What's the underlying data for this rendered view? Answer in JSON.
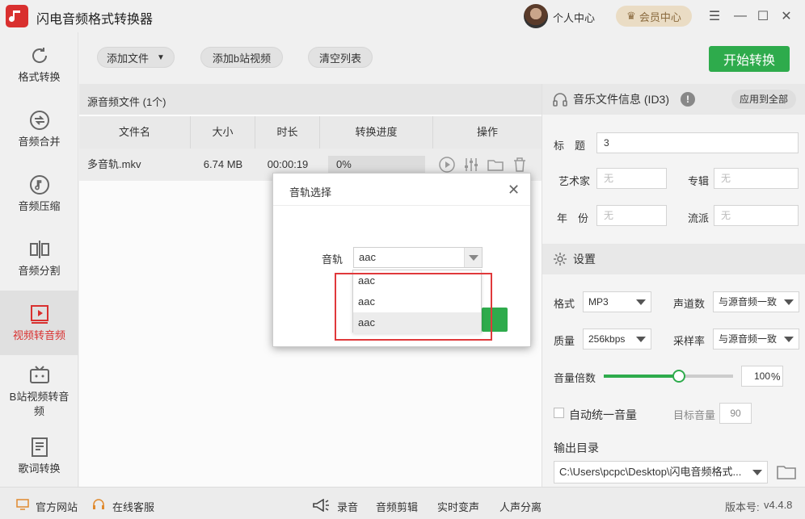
{
  "app": {
    "title": "闪电音频格式转换器",
    "user_center": "个人中心",
    "vip": "会员中心"
  },
  "sidebar": {
    "items": [
      {
        "label": "格式转换"
      },
      {
        "label": "音频合并"
      },
      {
        "label": "音频压缩"
      },
      {
        "label": "音频分割"
      },
      {
        "label": "视频转音频"
      },
      {
        "label": "B站视频转音频"
      },
      {
        "label": "歌词转换"
      }
    ]
  },
  "toolbar": {
    "add_file": "添加文件",
    "add_bili": "添加b站视频",
    "clear": "清空列表",
    "start": "开始转换"
  },
  "files": {
    "header": "源音频文件 (1个)",
    "columns": [
      "文件名",
      "大小",
      "时长",
      "转换进度",
      "操作"
    ],
    "rows": [
      {
        "name": "多音轨.mkv",
        "size": "6.74 MB",
        "duration": "00:00:19",
        "progress": "0%"
      }
    ]
  },
  "id3": {
    "title": "音乐文件信息 (ID3)",
    "apply_all": "应用到全部",
    "label_title": "标　题",
    "value_title": "3",
    "label_artist": "艺术家",
    "ph_artist": "无",
    "label_album": "专辑",
    "ph_album": "无",
    "label_year": "年　份",
    "ph_year": "无",
    "label_genre": "流派",
    "ph_genre": "无"
  },
  "settings": {
    "title": "设置",
    "format_label": "格式",
    "format_value": "MP3",
    "channels_label": "声道数",
    "channels_value": "与源音频一致",
    "quality_label": "质量",
    "quality_value": "256kbps",
    "samplerate_label": "采样率",
    "samplerate_value": "与源音频一致",
    "volume_label": "音量倍数",
    "volume_value": "100",
    "volume_unit": "%",
    "volume_level": 0.58,
    "auto_volume_label": "自动统一音量",
    "target_label": "目标音量",
    "target_value": "90",
    "output_label": "输出目录",
    "output_path": "C:\\Users\\pcpc\\Desktop\\闪电音频格式..."
  },
  "bottom": {
    "site": "官方网站",
    "support": "在线客服",
    "record": "录音",
    "cut": "音频剪辑",
    "voice": "实时变声",
    "vocal": "人声分离",
    "version_label": "版本号:",
    "version": "v4.4.8"
  },
  "dialog": {
    "title": "音轨选择",
    "track_label": "音轨",
    "track_value": "aac",
    "options": [
      "aac",
      "aac",
      "aac"
    ]
  },
  "colors": {
    "accent": "#d9302f",
    "green": "#2eab4c",
    "highlight": "#e0393b"
  }
}
